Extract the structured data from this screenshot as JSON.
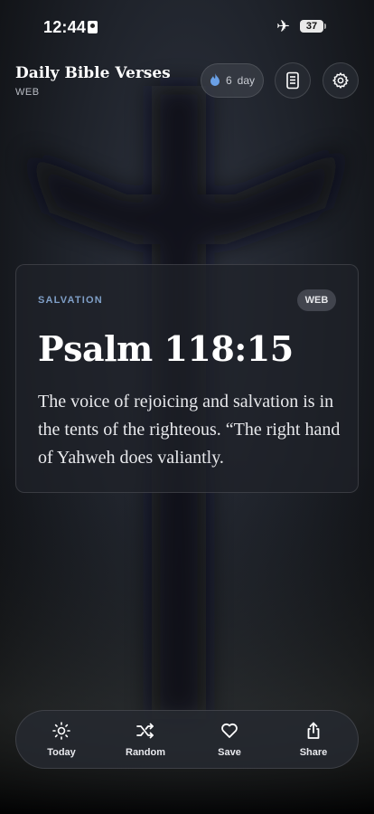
{
  "status_bar": {
    "time": "12:44",
    "battery": "37"
  },
  "header": {
    "app_title": "Daily Bible Verses",
    "translation": "WEB",
    "streak_count": "6",
    "streak_unit": "day"
  },
  "verse_card": {
    "category": "SALVATION",
    "translation_badge": "WEB",
    "reference": "Psalm 118:15",
    "text": "The voice of rejoicing and salvation is in the tents of the righteous. “The right hand of Yahweh does valiantly."
  },
  "tab_bar": {
    "today": "Today",
    "random": "Random",
    "save": "Save",
    "share": "Share"
  },
  "colors": {
    "accent_blue": "#7f9fc7",
    "flame": "#6aa0e6"
  }
}
